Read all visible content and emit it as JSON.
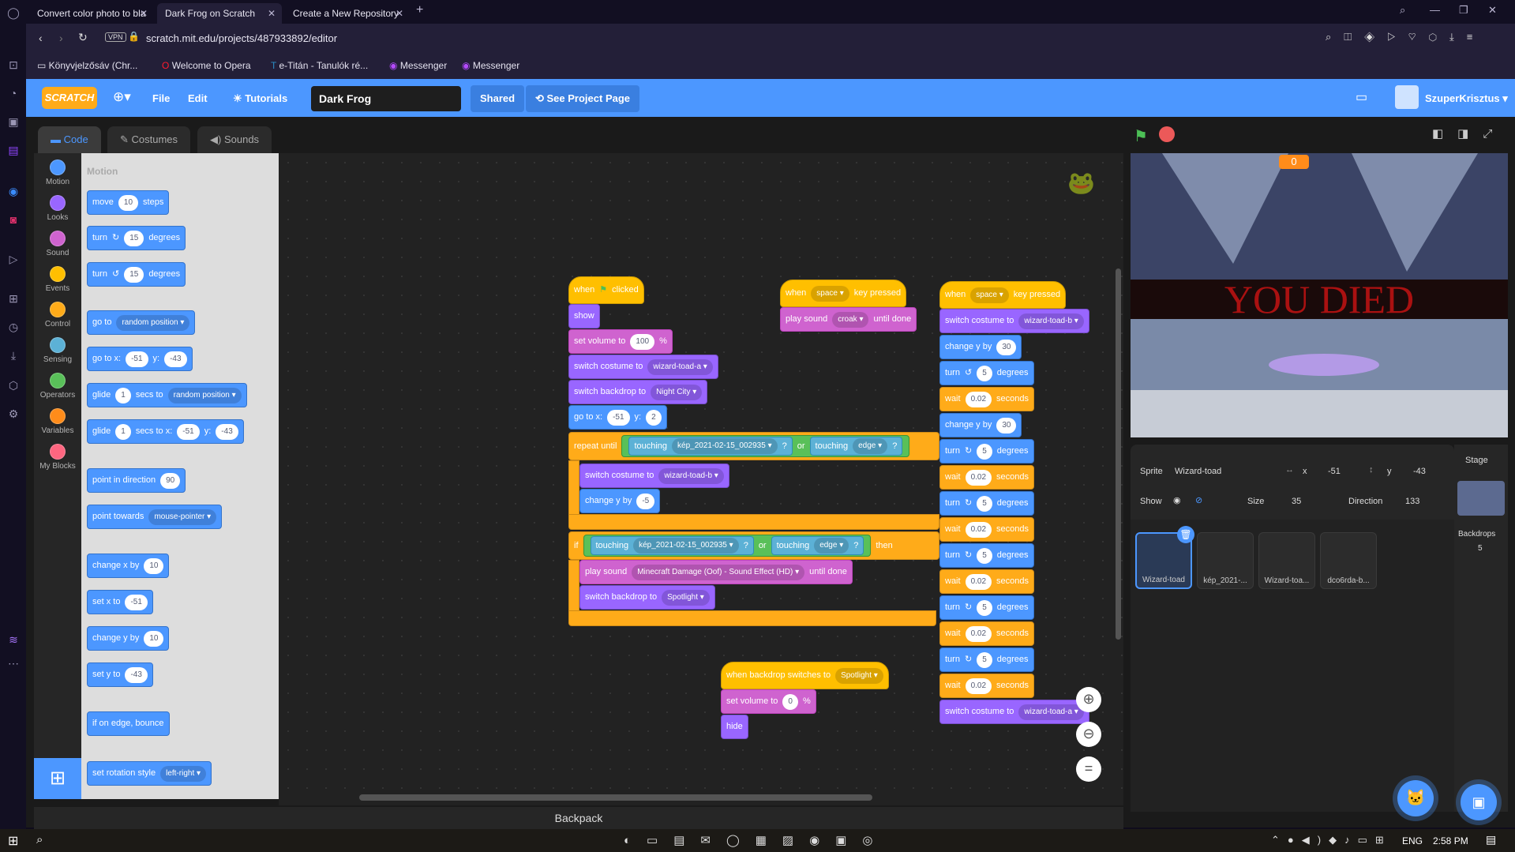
{
  "browser": {
    "tabs": [
      {
        "title": "Convert color photo to bla"
      },
      {
        "title": "Dark Frog on Scratch"
      },
      {
        "title": "Create a New Repository"
      }
    ],
    "vpn": "VPN",
    "url": "scratch.mit.edu/projects/487933892/editor",
    "bookmarks": [
      "Könyvjelzősáv (Chr...",
      "Welcome to Opera",
      "e-Titán - Tanulók ré...",
      "Messenger",
      "Messenger"
    ]
  },
  "menubar": {
    "logo": "SCRATCH",
    "file": "File",
    "edit": "Edit",
    "tutorials": "Tutorials",
    "project_title": "Dark Frog",
    "shared": "Shared",
    "see_project": "See Project Page",
    "username": "SzuperKrisztus"
  },
  "editor_tabs": {
    "code": "Code",
    "costumes": "Costumes",
    "sounds": "Sounds"
  },
  "categories": [
    {
      "label": "Motion",
      "color": "#4c97ff"
    },
    {
      "label": "Looks",
      "color": "#9966ff"
    },
    {
      "label": "Sound",
      "color": "#cf63cf"
    },
    {
      "label": "Events",
      "color": "#ffbf00"
    },
    {
      "label": "Control",
      "color": "#ffab19"
    },
    {
      "label": "Sensing",
      "color": "#5cb1d6"
    },
    {
      "label": "Operators",
      "color": "#59c059"
    },
    {
      "label": "Variables",
      "color": "#ff8c1a"
    },
    {
      "label": "My Blocks",
      "color": "#ff6680"
    }
  ],
  "palette": {
    "title": "Motion",
    "move": "move",
    "move_val": "10",
    "steps": "steps",
    "turn": "turn",
    "turn_val": "15",
    "degrees": "degrees",
    "go_to": "go to",
    "random_position": "random position",
    "go_to_x": "go to x:",
    "x_val": "-51",
    "y": "y:",
    "y_val": "-43",
    "glide": "glide",
    "glide_val": "1",
    "secs_to": "secs to",
    "secs_to_x": "secs to x:",
    "point_in_direction": "point in direction",
    "dir_val": "90",
    "point_towards": "point towards",
    "mouse_pointer": "mouse-pointer",
    "change_x_by": "change x by",
    "change_val": "10",
    "set_x_to": "set x to",
    "set_y_to": "set y to",
    "change_y_by": "change y by",
    "if_on_edge": "if on edge, bounce",
    "set_rotation_style": "set rotation style",
    "left_right": "left-right"
  },
  "scripts": {
    "when": "when",
    "clicked": "clicked",
    "show": "show",
    "set_volume_to": "set volume to",
    "vol100": "100",
    "pct": "%",
    "switch_costume_to": "switch costume to",
    "wizard_a": "wizard-toad-a",
    "wizard_b": "wizard-toad-b",
    "switch_backdrop_to": "switch backdrop to",
    "night_city": "Night City",
    "go_to_x": "go to x:",
    "gx": "-51",
    "y": "y:",
    "gy": "2",
    "repeat_until": "repeat until",
    "touching": "touching",
    "kep": "kép_2021-02-15_002935",
    "q": "?",
    "or": "or",
    "edge": "edge",
    "change_y_by": "change y by",
    "neg5": "-5",
    "if": "if",
    "then": "then",
    "play_sound": "play sound",
    "minecraft": "Minecraft Damage (Oof) - Sound Effect (HD)",
    "until_done": "until done",
    "spotlight": "Spotlight",
    "space": "space",
    "key_pressed": "key pressed",
    "croak": "croak",
    "cy30": "30",
    "turn": "turn",
    "deg5": "5",
    "degrees": "degrees",
    "wait": "wait",
    "w002": "0.02",
    "seconds": "seconds",
    "when_backdrop": "when backdrop switches to",
    "vol0": "0",
    "hide": "hide"
  },
  "stage": {
    "score": "0",
    "you_died": "YOU DIED"
  },
  "sprite_info": {
    "sprite_label": "Sprite",
    "sprite_name": "Wizard-toad",
    "x_label": "x",
    "x": "-51",
    "y_label": "y",
    "y": "-43",
    "show": "Show",
    "size_label": "Size",
    "size": "35",
    "direction_label": "Direction",
    "direction": "133"
  },
  "sprites": [
    "Wizard-toad",
    "kép_2021-...",
    "Wizard-toa...",
    "dco6rda-b..."
  ],
  "stage_panel": {
    "title": "Stage",
    "backdrops_label": "Backdrops",
    "backdrops_count": "5"
  },
  "backpack": "Backpack",
  "taskbar": {
    "lang": "ENG",
    "time": "2:58 PM"
  }
}
